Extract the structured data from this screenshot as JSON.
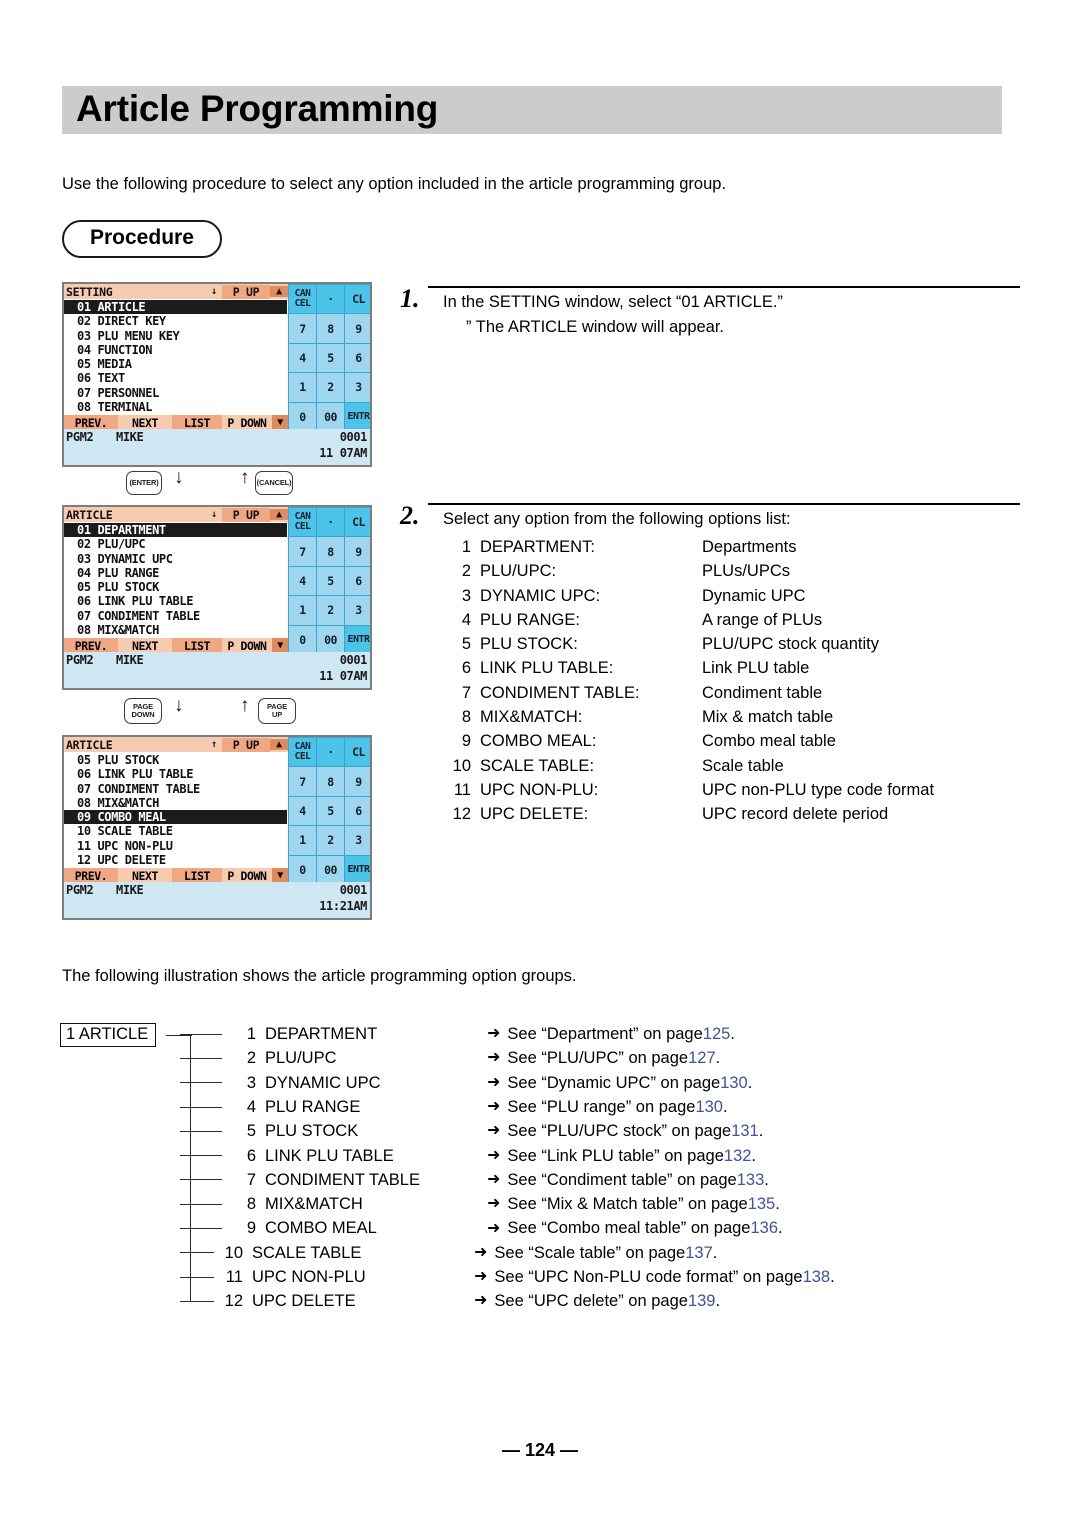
{
  "page": {
    "title": "Article Programming",
    "intro": "Use the following procedure to select any option included in the article programming group.",
    "procedure_label": "Procedure",
    "illustration_intro": "The following illustration shows the article programming option groups.",
    "footer": "— 124 —"
  },
  "steps": [
    {
      "number": "1.",
      "line1": "In the SETTING window, select “01 ARTICLE.”",
      "line2": "” The ARTICLE window will appear."
    },
    {
      "number": "2.",
      "line1": "Select any option from the following options list:"
    }
  ],
  "options": [
    {
      "index": "1",
      "name": "DEPARTMENT:",
      "desc": "Departments"
    },
    {
      "index": "2",
      "name": "PLU/UPC:",
      "desc": "PLUs/UPCs"
    },
    {
      "index": "3",
      "name": "DYNAMIC UPC:",
      "desc": "Dynamic UPC"
    },
    {
      "index": "4",
      "name": "PLU RANGE:",
      "desc": "A range of PLUs"
    },
    {
      "index": "5",
      "name": "PLU STOCK:",
      "desc": "PLU/UPC stock quantity"
    },
    {
      "index": "6",
      "name": "LINK PLU TABLE:",
      "desc": "Link PLU table"
    },
    {
      "index": "7",
      "name": "CONDIMENT TABLE:",
      "desc": "Condiment table"
    },
    {
      "index": "8",
      "name": "MIX&MATCH:",
      "desc": "Mix & match table"
    },
    {
      "index": "9",
      "name": "COMBO MEAL:",
      "desc": "Combo meal table"
    },
    {
      "index": "10",
      "name": "SCALE TABLE:",
      "desc": "Scale table"
    },
    {
      "index": "11",
      "name": "UPC NON-PLU:",
      "desc": "UPC non-PLU type code format"
    },
    {
      "index": "12",
      "name": "UPC DELETE:",
      "desc": "UPC record delete period"
    }
  ],
  "screens": [
    {
      "title": "SETTING",
      "scroll_arrow": "↓",
      "page_btn": "P UP",
      "page_arrow": "▲",
      "rows": [
        {
          "text": "01 ARTICLE",
          "selected": true
        },
        {
          "text": "02 DIRECT KEY",
          "selected": false
        },
        {
          "text": "03 PLU MENU KEY",
          "selected": false
        },
        {
          "text": "04 FUNCTION",
          "selected": false
        },
        {
          "text": "05 MEDIA",
          "selected": false
        },
        {
          "text": "06 TEXT",
          "selected": false
        },
        {
          "text": "07 PERSONNEL",
          "selected": false
        },
        {
          "text": "08 TERMINAL",
          "selected": false
        }
      ],
      "bottom": {
        "prev": "PREV.",
        "next": "NEXT",
        "list": "LIST",
        "pdown": "P DOWN",
        "arrow": "▼"
      },
      "status": {
        "mode": "PGM2",
        "user": "MIKE",
        "register": "0001",
        "time": "11 07AM"
      }
    },
    {
      "title": "ARTICLE",
      "scroll_arrow": "↓",
      "page_btn": "P UP",
      "page_arrow": "▲",
      "rows": [
        {
          "text": "01 DEPARTMENT",
          "selected": true
        },
        {
          "text": "02 PLU/UPC",
          "selected": false
        },
        {
          "text": "03 DYNAMIC UPC",
          "selected": false
        },
        {
          "text": "04 PLU RANGE",
          "selected": false
        },
        {
          "text": "05 PLU STOCK",
          "selected": false
        },
        {
          "text": "06 LINK PLU TABLE",
          "selected": false
        },
        {
          "text": "07 CONDIMENT TABLE",
          "selected": false
        },
        {
          "text": "08 MIX&MATCH",
          "selected": false
        }
      ],
      "bottom": {
        "prev": "PREV.",
        "next": "NEXT",
        "list": "LIST",
        "pdown": "P DOWN",
        "arrow": "▼"
      },
      "status": {
        "mode": "PGM2",
        "user": "MIKE",
        "register": "0001",
        "time": "11 07AM"
      }
    },
    {
      "title": "ARTICLE",
      "scroll_arrow": "↑",
      "page_btn": "P UP",
      "page_arrow": "▲",
      "rows": [
        {
          "text": "05 PLU STOCK",
          "selected": false
        },
        {
          "text": "06 LINK PLU TABLE",
          "selected": false
        },
        {
          "text": "07 CONDIMENT TABLE",
          "selected": false
        },
        {
          "text": "08 MIX&MATCH",
          "selected": false
        },
        {
          "text": "09 COMBO MEAL",
          "selected": true
        },
        {
          "text": "10 SCALE TABLE",
          "selected": false
        },
        {
          "text": "11 UPC NON-PLU",
          "selected": false
        },
        {
          "text": "12 UPC DELETE",
          "selected": false
        }
      ],
      "bottom": {
        "prev": "PREV.",
        "next": "NEXT",
        "list": "LIST",
        "pdown": "P DOWN",
        "arrow": "▼"
      },
      "status": {
        "mode": "PGM2",
        "user": "MIKE",
        "register": "0001",
        "time": "11:21AM"
      }
    }
  ],
  "keypad": {
    "cancel_line1": "CAN",
    "cancel_line2": "CEL",
    "dot": "·",
    "cl": "CL",
    "k7": "7",
    "k8": "8",
    "k9": "9",
    "k4": "4",
    "k5": "5",
    "k6": "6",
    "k1": "1",
    "k2": "2",
    "k3": "3",
    "k0": "0",
    "k00": "00",
    "entr": "ENTR"
  },
  "keycaps": {
    "enter": "(ENTER)",
    "cancel": "(CANCEL)",
    "page_down_l1": "PAGE",
    "page_down_l2": "DOWN",
    "page_up_l1": "PAGE",
    "page_up_l2": "UP",
    "down_arrow": "↓",
    "up_arrow": "↑"
  },
  "tree": {
    "root": "1 ARTICLE",
    "arrow_glyph": "➜",
    "rows": [
      {
        "num": "1",
        "label": "DEPARTMENT",
        "see": "See “Department” on page ",
        "page": "125",
        "end": "."
      },
      {
        "num": "2",
        "label": "PLU/UPC",
        "see": "See “PLU/UPC” on page ",
        "page": "127",
        "end": "."
      },
      {
        "num": "3",
        "label": "DYNAMIC UPC",
        "see": "See “Dynamic UPC” on page ",
        "page": "130",
        "end": "."
      },
      {
        "num": "4",
        "label": "PLU RANGE",
        "see": "See “PLU range” on page ",
        "page": "130",
        "end": "."
      },
      {
        "num": "5",
        "label": "PLU STOCK",
        "see": "See “PLU/UPC stock” on page ",
        "page": "131",
        "end": "."
      },
      {
        "num": "6",
        "label": "LINK PLU TABLE",
        "see": "See “Link PLU table” on page ",
        "page": "132",
        "end": "."
      },
      {
        "num": "7",
        "label": "CONDIMENT TABLE",
        "see": "See “Condiment table” on page ",
        "page": "133",
        "end": "."
      },
      {
        "num": "8",
        "label": "MIX&MATCH",
        "see": "See “Mix & Match table” on page ",
        "page": "135",
        "end": "."
      },
      {
        "num": "9",
        "label": "COMBO MEAL",
        "see": "See “Combo meal table” on page ",
        "page": "136",
        "end": "."
      },
      {
        "num": "10",
        "label": "SCALE TABLE",
        "see": "See “Scale table” on page ",
        "page": "137",
        "end": "."
      },
      {
        "num": "11",
        "label": "UPC NON-PLU",
        "see": "See “UPC Non-PLU code format” on page ",
        "page": "138",
        "end": "."
      },
      {
        "num": "12",
        "label": "UPC DELETE",
        "see": "See “UPC delete” on page ",
        "page": "139",
        "end": "."
      }
    ]
  },
  "colors": {
    "banner_gray": "#cccccc",
    "lcd_titlebar": "#f6cbb0",
    "lcd_accent": "#f0a882",
    "lcd_keypad_blue": "#9fd6ef",
    "lcd_bright_blue": "#4cc3e8",
    "page_ref_blue": "#3f51a8"
  }
}
